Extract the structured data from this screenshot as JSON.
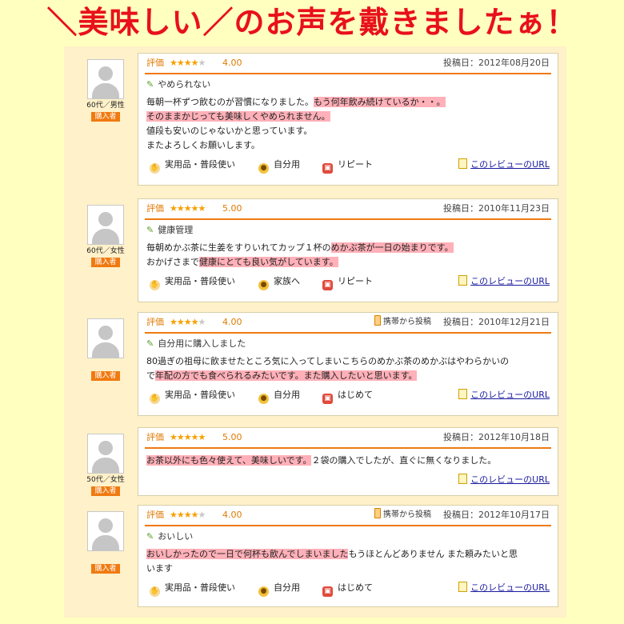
{
  "headline": "＼美味しい／のお声を戴きましたぁ！",
  "reviews": [
    {
      "demographic": "60代／男性",
      "badge": "購入者",
      "rating_label": "評価",
      "rating": 4,
      "score": "4.00",
      "mobile": "",
      "posted": "投稿日：2012年08月20日",
      "title": "やめられない",
      "lines": [
        [
          {
            "t": "毎朝一杯ずつ飲むのが習慣になりました。",
            "h": false
          },
          {
            "t": "もう何年飲み続けているか・・。",
            "h": true
          }
        ],
        [
          {
            "t": "そのままかじっても美味しくやめられません。",
            "h": true
          }
        ],
        [
          {
            "t": "値段も安いのじゃないかと思っています。",
            "h": false
          }
        ],
        [
          {
            "t": "またよろしくお願いします。",
            "h": false
          }
        ]
      ],
      "tags": [
        "実用品・普段使い",
        "自分用",
        "リピート"
      ],
      "link": "このレビューのURL"
    },
    {
      "demographic": "60代／女性",
      "badge": "購入者",
      "rating_label": "評価",
      "rating": 5,
      "score": "5.00",
      "mobile": "",
      "posted": "投稿日：2010年11月23日",
      "title": "健康管理",
      "lines": [
        [
          {
            "t": "毎朝めかぶ茶に生姜をすりいれてカップ１杯の",
            "h": false
          },
          {
            "t": "めかぶ茶が一日の始まりです。",
            "h": true
          }
        ],
        [
          {
            "t": "おかげさまで",
            "h": false
          },
          {
            "t": "健康にとても良い気がしています。",
            "h": true
          }
        ]
      ],
      "tags": [
        "実用品・普段使い",
        "家族へ",
        "リピート"
      ],
      "link": "このレビューのURL"
    },
    {
      "demographic": "",
      "badge": "購入者",
      "rating_label": "評価",
      "rating": 4,
      "score": "4.00",
      "mobile": "携帯から投稿",
      "posted": "投稿日：2010年12月21日",
      "title": "自分用に購入しました",
      "lines": [
        [
          {
            "t": "80過ぎの祖母に飲ませたところ気に入ってしまいこちらのめかぶ茶のめかぶはやわらかいの",
            "h": false
          }
        ],
        [
          {
            "t": "で",
            "h": false
          },
          {
            "t": "年配の方でも食べられるみたいです。また購入したいと思います。",
            "h": true
          }
        ]
      ],
      "tags": [
        "実用品・普段使い",
        "自分用",
        "はじめて"
      ],
      "link": "このレビューのURL"
    },
    {
      "demographic": "50代／女性",
      "badge": "購入者",
      "rating_label": "評価",
      "rating": 5,
      "score": "5.00",
      "mobile": "",
      "posted": "投稿日：2012年10月18日",
      "title": "",
      "lines": [
        [
          {
            "t": "お茶以外にも色々使えて、美味しいです。",
            "h": true
          },
          {
            "t": "２袋の購入でしたが、直ぐに無くなりました。",
            "h": false
          }
        ]
      ],
      "tags": [],
      "link": "このレビューのURL"
    },
    {
      "demographic": "",
      "badge": "購入者",
      "rating_label": "評価",
      "rating": 4,
      "score": "4.00",
      "mobile": "携帯から投稿",
      "posted": "投稿日：2012年10月17日",
      "title": "おいしい",
      "lines": [
        [
          {
            "t": "おいしかったので一日で何杯も飲んでしまいました",
            "h": true
          },
          {
            "t": "もうほとんどありません また頼みたいと思",
            "h": false
          }
        ],
        [
          {
            "t": "います",
            "h": false
          }
        ]
      ],
      "tags": [
        "実用品・普段使い",
        "自分用",
        "はじめて"
      ],
      "link": "このレビューのURL"
    }
  ]
}
